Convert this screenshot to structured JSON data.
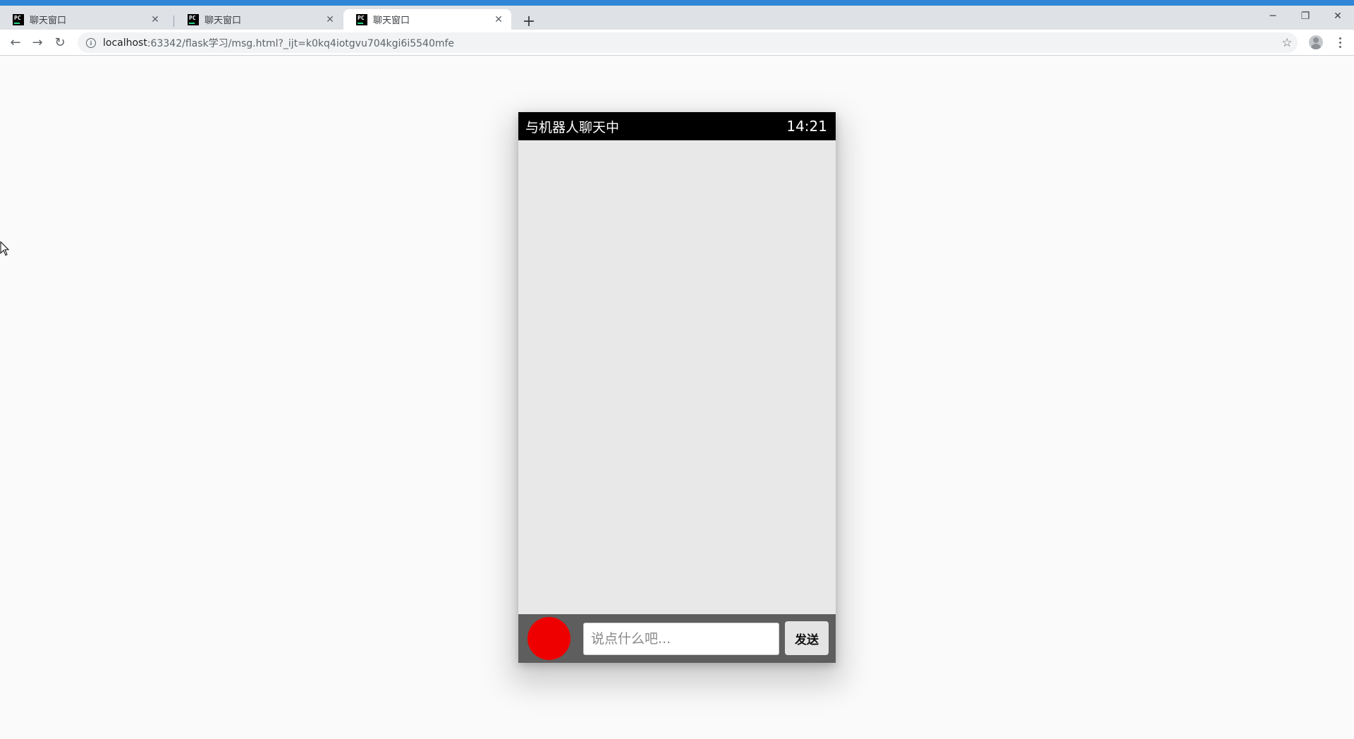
{
  "browser": {
    "tabs": [
      {
        "title": "聊天窗口",
        "active": false
      },
      {
        "title": "聊天窗口",
        "active": false
      },
      {
        "title": "聊天窗口",
        "active": true
      }
    ],
    "new_tab_label": "+",
    "url_host": "localhost",
    "url_rest": ":63342/flask学习/msg.html?_ijt=k0kq4iotgvu704kgi6i5540mfe",
    "icons": {
      "back": "back-arrow-icon",
      "forward": "forward-arrow-icon",
      "reload": "reload-icon",
      "info": "info-icon",
      "bookmark": "star-icon",
      "profile": "avatar-icon",
      "menu": "kebab-menu-icon"
    },
    "accent_color": "#2f86d6"
  },
  "chat": {
    "header_title": "与机器人聊天中",
    "time": "14:21",
    "input_placeholder": "说点什么吧...",
    "input_value": "",
    "send_label": "发送",
    "record_button_color": "#ee0000",
    "header_color": "#000000",
    "bar_color": "#5e5e5e"
  }
}
